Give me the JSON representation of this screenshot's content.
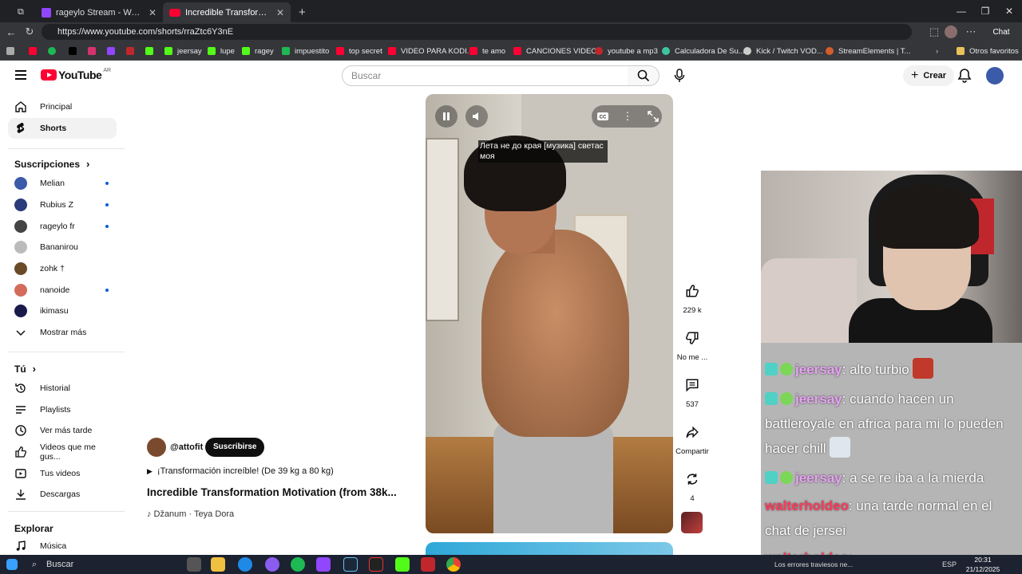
{
  "browser": {
    "tabs": [
      {
        "title": "rageylo Stream - Watch Live o"
      },
      {
        "title": "Incredible Transformation Mo"
      }
    ],
    "url": "https://www.youtube.com/shorts/rraZtc6Y3nE",
    "chat_button": "Chat",
    "bookmarks": [
      "jeersay",
      "lupe",
      "ragey",
      "impuestito",
      "top secret",
      "VIDEO PARA KODI...",
      "te amo",
      "CANCIONES VIDEOS",
      "youtube a mp3",
      "Calculadora De Su...",
      "Kick / Twitch VOD...",
      "StreamElements | T..."
    ],
    "other_bookmarks": "Otros favoritos"
  },
  "header": {
    "logo_text": "YouTube",
    "country_code": "AR",
    "search_placeholder": "Buscar",
    "create_label": "Crear"
  },
  "sidebar": {
    "main": [
      {
        "label": "Principal"
      },
      {
        "label": "Shorts"
      }
    ],
    "subscriptions_heading": "Suscripciones",
    "subscriptions": [
      {
        "label": "Melian",
        "color": "#3b5aa8"
      },
      {
        "label": "Rubius Z",
        "color": "#2a3a7a"
      },
      {
        "label": "rageylo fr",
        "color": "#444444"
      },
      {
        "label": "Bananirou",
        "color": "#bbbbbb"
      },
      {
        "label": "zohk †",
        "color": "#6b4a2a"
      },
      {
        "label": "nanoide",
        "color": "#d46b5a"
      },
      {
        "label": "ikimasu",
        "color": "#1a1a4a"
      }
    ],
    "show_more": "Mostrar más",
    "you_heading": "Tú",
    "you_items": [
      {
        "label": "Historial"
      },
      {
        "label": "Playlists"
      },
      {
        "label": "Ver más tarde"
      },
      {
        "label": "Videos que me gus..."
      },
      {
        "label": "Tus videos"
      },
      {
        "label": "Descargas"
      }
    ],
    "explore_heading": "Explorar",
    "explore_items": [
      {
        "label": "Música"
      }
    ]
  },
  "player": {
    "caption": "Лета не до края [музика] светас моя"
  },
  "actions": {
    "likes": "229 k",
    "dislike": "No me ...",
    "comments": "537",
    "share": "Compartir",
    "remix": "4"
  },
  "video": {
    "channel": "@attofit",
    "subscribe": "Suscribirse",
    "description": "¡Transformación increíble! (De 39 kg a 80 kg)",
    "title": "Incredible Transformation Motivation (from 38k...",
    "music": "Džanum · Teya Dora"
  },
  "chat": [
    {
      "user": "jeersay",
      "message": ": alto turbio"
    },
    {
      "user": "jeersay",
      "message": ": cuando hacen un battleroyale en africa para mi lo pueden hacer chill"
    },
    {
      "user": "jeersay",
      "message": ": a se re iba a la mierda"
    },
    {
      "user": "walterholdeo",
      "message": ": una tarde normal en el chat de jersei"
    },
    {
      "user": "walterholdeo",
      "message": ":"
    }
  ],
  "taskbar": {
    "search": "Buscar",
    "notification": "Los errores traviesos ne...",
    "lang": "ESP",
    "time": "20:31",
    "date": "21/12/2025"
  }
}
